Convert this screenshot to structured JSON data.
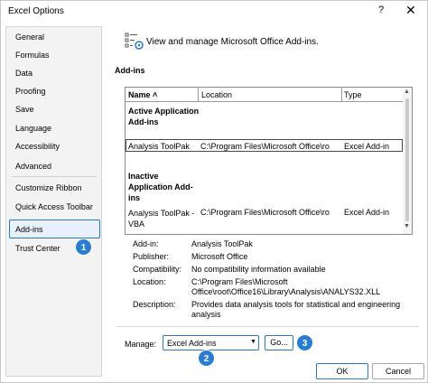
{
  "window": {
    "title": "Excel Options",
    "help": "?",
    "close": "✕"
  },
  "sidebar": {
    "items": [
      {
        "label": "General"
      },
      {
        "label": "Formulas"
      },
      {
        "label": "Data"
      },
      {
        "label": "Proofing"
      },
      {
        "label": "Save"
      },
      {
        "label": "Language"
      },
      {
        "label": "Accessibility"
      },
      {
        "label": "Advanced"
      },
      {
        "label": "Customize Ribbon"
      },
      {
        "label": "Quick Access Toolbar"
      },
      {
        "label": "Add-ins"
      },
      {
        "label": "Trust Center"
      }
    ],
    "selected": "Add-ins"
  },
  "header": {
    "text": "View and manage Microsoft Office Add-ins."
  },
  "addins": {
    "section_label": "Add-ins",
    "columns": {
      "name": "Name ˄",
      "location": "Location",
      "type": "Type"
    },
    "groups": [
      {
        "label": "Active Application Add-ins",
        "rows": [
          {
            "name": "Analysis ToolPak",
            "location": "C:\\Program Files\\Microsoft Office\\ro",
            "type": "Excel Add-in"
          }
        ]
      },
      {
        "label": "Inactive Application Add-ins",
        "rows": [
          {
            "name": "Analysis ToolPak - VBA",
            "location": "C:\\Program Files\\Microsoft Office\\ro",
            "type": "Excel Add-in"
          }
        ]
      }
    ]
  },
  "details": {
    "addin": {
      "label": "Add-in:",
      "value": "Analysis ToolPak"
    },
    "publisher": {
      "label": "Publisher:",
      "value": "Microsoft Office"
    },
    "compatibility": {
      "label": "Compatibility:",
      "value": "No compatibility information available"
    },
    "location": {
      "label": "Location:",
      "value": "C:\\Program Files\\Microsoft Office\\root\\Office16\\Library\\Analysis\\ANALYS32.XLL"
    },
    "description": {
      "label": "Description:",
      "value": "Provides data analysis tools for statistical and engineering analysis"
    }
  },
  "manage": {
    "label": "Manage:",
    "selected": "Excel Add-ins",
    "go_label": "Go..."
  },
  "buttons": {
    "ok": "OK",
    "cancel": "Cancel"
  },
  "badges": {
    "one": "1",
    "two": "2",
    "three": "3"
  },
  "colors": {
    "accent": "#2b78c5",
    "badge": "#2b7cd3",
    "sidebar_bg": "#f3f3f3"
  }
}
